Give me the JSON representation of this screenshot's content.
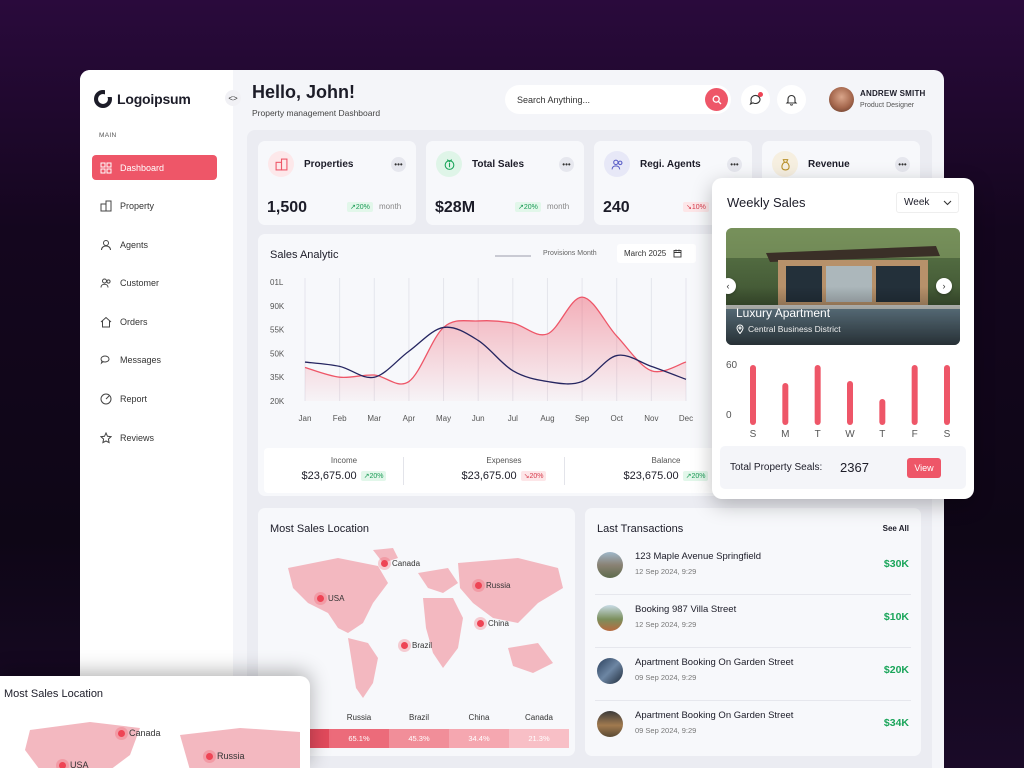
{
  "brand": {
    "name": "Logoipsum"
  },
  "sidebar": {
    "section_label": "MAIN",
    "items": [
      {
        "label": "Dashboard",
        "icon": "grid-icon",
        "active": true
      },
      {
        "label": "Property",
        "icon": "building-icon"
      },
      {
        "label": "Agents",
        "icon": "agent-icon"
      },
      {
        "label": "Customer",
        "icon": "users-icon"
      },
      {
        "label": "Orders",
        "icon": "home-icon"
      },
      {
        "label": "Messages",
        "icon": "chat-icon"
      },
      {
        "label": "Report",
        "icon": "report-icon"
      },
      {
        "label": "Reviews",
        "icon": "star-icon"
      }
    ]
  },
  "header": {
    "greeting": "Hello, John!",
    "subtitle": "Property management Dashboard",
    "search_placeholder": "Search Anything...",
    "user_name": "ANDREW SMITH",
    "user_role": "Product Designer"
  },
  "stats": [
    {
      "title": "Properties",
      "value": "1,500",
      "change": "20%",
      "direction": "up",
      "unit": "month",
      "icon": "building-icon",
      "icon_bg": "#fde8ea",
      "icon_color": "#ee5668"
    },
    {
      "title": "Total Sales",
      "value": "$28M",
      "change": "20%",
      "direction": "up",
      "unit": "month",
      "icon": "money-icon",
      "icon_bg": "#dff5e8",
      "icon_color": "#1aa55a"
    },
    {
      "title": "Regi. Agents",
      "value": "240",
      "change": "10%",
      "direction": "down",
      "unit": "",
      "icon": "users-icon",
      "icon_bg": "#e7e8f7",
      "icon_color": "#5b5fc7"
    },
    {
      "title": "Revenue",
      "value": "",
      "change": "",
      "direction": "",
      "unit": "",
      "icon": "bag-icon",
      "icon_bg": "#f6efe0",
      "icon_color": "#b8902a"
    }
  ],
  "analytic": {
    "title": "Sales Analytic",
    "legend": "Provisions Month",
    "month": "March 2025",
    "totals": [
      {
        "label": "Income",
        "value": "$23,675.00",
        "change": "20%",
        "direction": "up"
      },
      {
        "label": "Expenses",
        "value": "$23,675.00",
        "change": "20%",
        "direction": "down"
      },
      {
        "label": "Balance",
        "value": "$23,675.00",
        "change": "20%",
        "direction": "up"
      }
    ]
  },
  "chart_data": [
    {
      "type": "area",
      "title": "Sales Analytic",
      "categories": [
        "Jan",
        "Feb",
        "Mar",
        "Apr",
        "May",
        "Jun",
        "Jul",
        "Aug",
        "Sep",
        "Oct",
        "Nov",
        "Dec"
      ],
      "y_tick_labels": [
        "01L",
        "90K",
        "55K",
        "50K",
        "35K",
        "20K"
      ],
      "series": [
        {
          "values": [
            51,
            42,
            44,
            38,
            88,
            94,
            92,
            82,
            116,
            80,
            48,
            56
          ],
          "color": "#ee5668"
        },
        {
          "values": [
            56,
            52,
            42,
            66,
            88,
            76,
            48,
            38,
            38,
            62,
            52,
            40
          ],
          "color": "#252560"
        }
      ],
      "ylim": [
        20,
        130
      ],
      "grid": true
    },
    {
      "type": "bar",
      "title": "Weekly Sales",
      "categories": [
        "S",
        "M",
        "T",
        "W",
        "T",
        "F",
        "S"
      ],
      "y_tick_labels": [
        "60",
        "0"
      ],
      "values": [
        60,
        42,
        60,
        44,
        26,
        60,
        60
      ],
      "ylim": [
        0,
        60
      ],
      "color": "#ee5668"
    }
  ],
  "weekly": {
    "title": "Weekly Sales",
    "period": "Week",
    "property_title": "Luxury Apartment",
    "property_location": "Central Business District",
    "total_label": "Total Property Seals:",
    "total_value": "2367",
    "view_label": "View"
  },
  "locations": {
    "title": "Most Sales Location",
    "markers": [
      "Canada",
      "USA",
      "Russia",
      "China",
      "Brazil"
    ],
    "bars": [
      {
        "country": "",
        "value": ""
      },
      {
        "country": "Russia",
        "value": "65.1%"
      },
      {
        "country": "Brazil",
        "value": "45.3%"
      },
      {
        "country": "China",
        "value": "34.4%"
      },
      {
        "country": "Canada",
        "value": "21.3%"
      }
    ]
  },
  "transactions": {
    "title": "Last Transactions",
    "see_all": "See All",
    "items": [
      {
        "title": "123 Maple Avenue Springfield",
        "date": "12 Sep 2024, 9:29",
        "amount": "$30K"
      },
      {
        "title": "Booking 987 Villa Street",
        "date": "12 Sep 2024, 9:29",
        "amount": "$10K"
      },
      {
        "title": "Apartment Booking On Garden Street",
        "date": "09 Sep 2024, 9:29",
        "amount": "$20K"
      },
      {
        "title": "Apartment Booking On Garden Street",
        "date": "09 Sep 2024, 9:29",
        "amount": "$34K"
      }
    ]
  },
  "float_location": {
    "title": "Most Sales Location",
    "markers": [
      "Canada",
      "Russia",
      "USA"
    ]
  }
}
